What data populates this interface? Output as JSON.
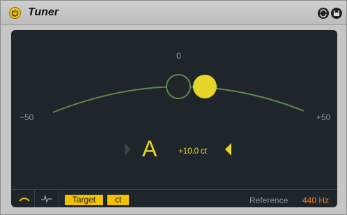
{
  "device": {
    "title": "Tuner",
    "accent_color": "#f2c200",
    "icons": {
      "power": "power-icon",
      "hot_swap": "hot-swap-icon",
      "save": "save-icon"
    }
  },
  "meter": {
    "scale_center": "0",
    "scale_min": "−50",
    "scale_max": "+50",
    "deviation_cents": 10
  },
  "readout": {
    "note": "A",
    "cents": "+10.0 ct"
  },
  "bottom_bar": {
    "target_label": "Target",
    "unit_label": "ct",
    "reference_label": "Reference",
    "reference_value": "440 Hz",
    "reference_color": "#ff7a1a",
    "mode_icons": [
      "classic-view-icon",
      "strobe-view-icon"
    ]
  }
}
